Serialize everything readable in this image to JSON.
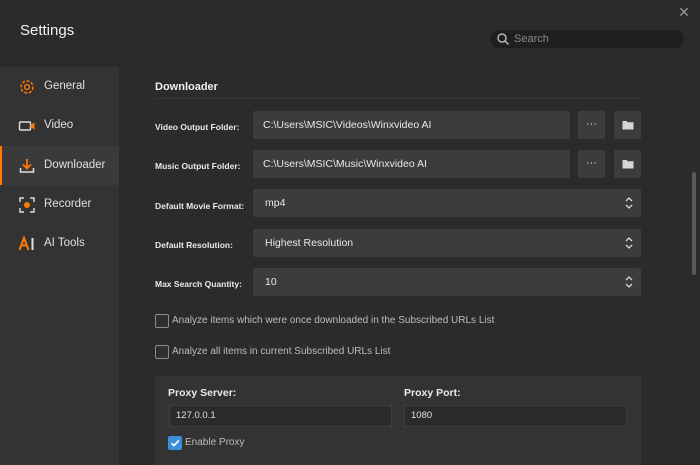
{
  "window": {
    "title": "Settings",
    "close_glyph": "✕"
  },
  "search": {
    "placeholder": "Search"
  },
  "sidebar": {
    "items": [
      {
        "label": "General",
        "icon": "gear-icon"
      },
      {
        "label": "Video",
        "icon": "video-camera-icon"
      },
      {
        "label": "Downloader",
        "icon": "download-icon",
        "active": true
      },
      {
        "label": "Recorder",
        "icon": "record-icon"
      },
      {
        "label": "AI Tools",
        "icon": "ai-icon"
      }
    ]
  },
  "downloader": {
    "section_title": "Downloader",
    "video_output": {
      "label": "Video Output Folder:",
      "value": "C:\\Users\\MSIC\\Videos\\Winxvideo AI",
      "browse_label": "···"
    },
    "music_output": {
      "label": "Music Output Folder:",
      "value": "C:\\Users\\MSIC\\Music\\Winxvideo AI",
      "browse_label": "···"
    },
    "movie_format": {
      "label": "Default Movie Format:",
      "value": "mp4"
    },
    "resolution": {
      "label": "Default Resolution:",
      "value": "Highest Resolution"
    },
    "max_search": {
      "label": "Max Search Quantity:",
      "value": "10"
    },
    "check_downloaded": {
      "label": "Analyze items which were once downloaded in the Subscribed URLs List",
      "checked": false
    },
    "check_all": {
      "label": "Analyze all items in current Subscribed URLs List",
      "checked": false
    },
    "proxy": {
      "server_label": "Proxy Server:",
      "server_value": "127.0.0.1",
      "port_label": "Proxy Port:",
      "port_value": "1080",
      "enable_label": "Enable Proxy",
      "enabled": true
    }
  },
  "colors": {
    "accent": "#ff7a00",
    "checkbox": "#3d8fdb",
    "background": "#2b2b2b",
    "sidebar": "#333333"
  }
}
